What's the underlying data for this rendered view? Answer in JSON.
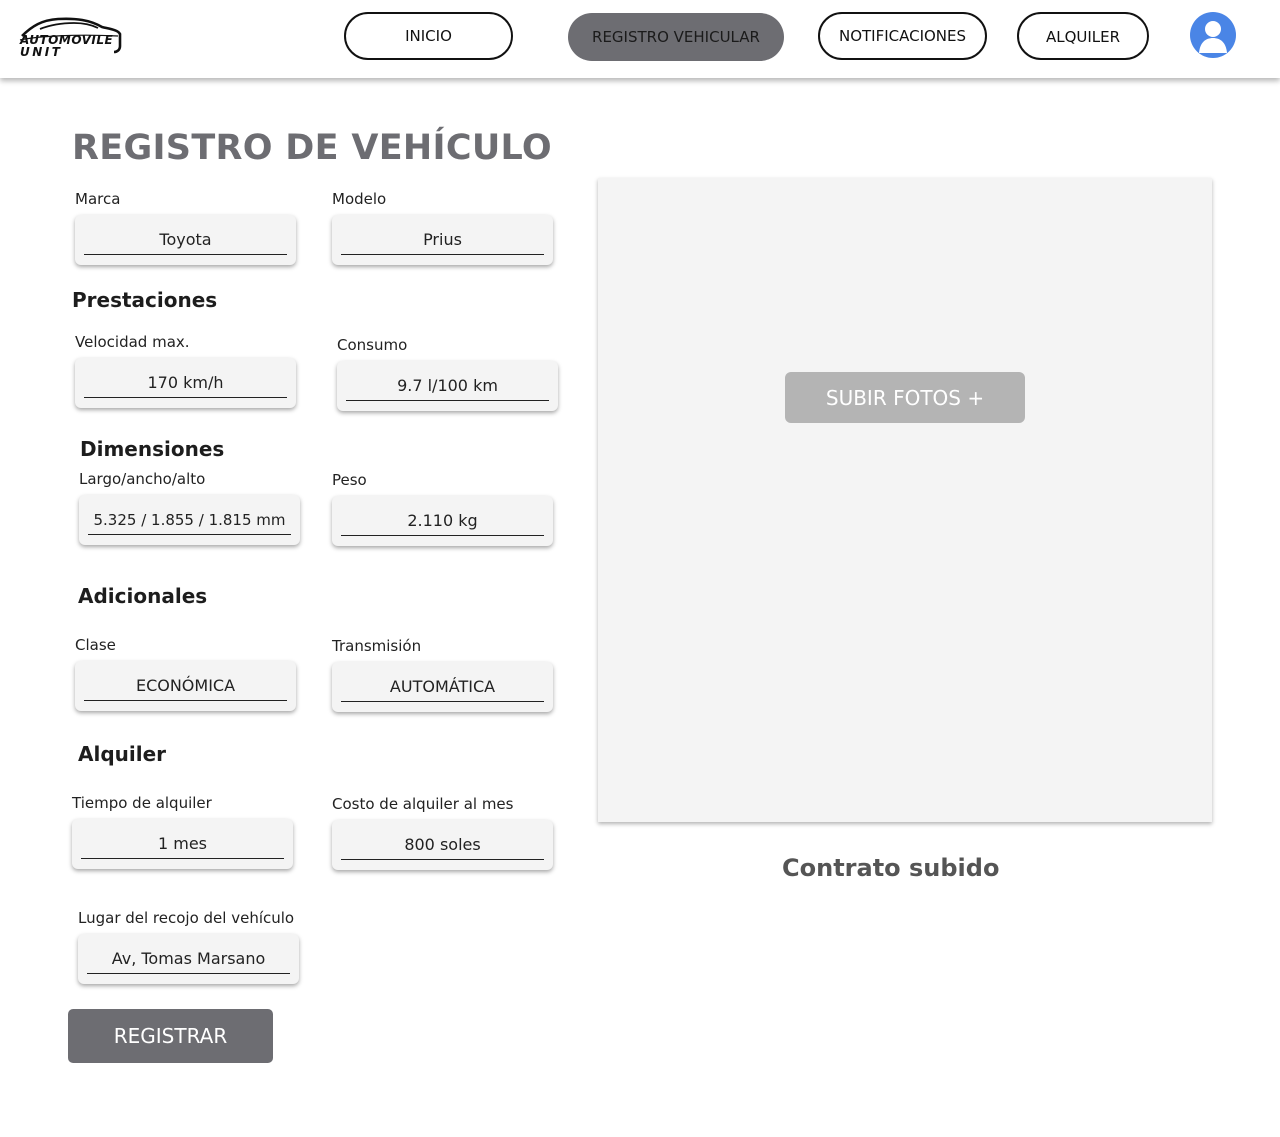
{
  "header": {
    "logo": {
      "line1": "AUTOMOVILE",
      "line2": "UNIT"
    },
    "nav": [
      {
        "label": "INICIO"
      },
      {
        "label": "REGISTRO VEHICULAR",
        "active": true
      },
      {
        "label": "NOTIFICACIONES"
      },
      {
        "label": "ALQUILER"
      }
    ],
    "avatar_icon": "user-avatar-icon"
  },
  "page": {
    "title": "REGISTRO DE VEHÍCULO",
    "fields": {
      "marca": {
        "label": "Marca",
        "value": "Toyota"
      },
      "modelo": {
        "label": "Modelo",
        "value": "Prius"
      },
      "velocidad": {
        "label": "Velocidad max.",
        "value": "170 km/h"
      },
      "consumo": {
        "label": "Consumo",
        "value": "9.7 l/100 km"
      },
      "dimensiones": {
        "label": "Largo/ancho/alto",
        "value": "5.325 / 1.855 / 1.815 mm"
      },
      "peso": {
        "label": "Peso",
        "value": "2.110 kg"
      },
      "clase": {
        "label": "Clase",
        "value": "ECONÓMICA"
      },
      "transmision": {
        "label": "Transmisión",
        "value": "AUTOMÁTICA"
      },
      "tiempo": {
        "label": "Tiempo de alquiler",
        "value": "1 mes"
      },
      "costo": {
        "label": "Costo de alquiler al mes",
        "value": "800 soles"
      },
      "lugar": {
        "label": "Lugar del recojo del vehículo",
        "value": "Av, Tomas Marsano"
      }
    },
    "sections": {
      "prestaciones": "Prestaciones",
      "dimensiones": "Dimensiones",
      "adicionales": "Adicionales",
      "alquiler": "Alquiler"
    },
    "register_label": "REGISTRAR",
    "upload_label": "SUBIR FOTOS +",
    "contract_status": "Contrato subido"
  },
  "colors": {
    "accent_gray": "#6d6d72",
    "field_bg": "#f4f4f4",
    "upload_bg": "#b4b4b4",
    "avatar_blue": "#4a85e6"
  }
}
